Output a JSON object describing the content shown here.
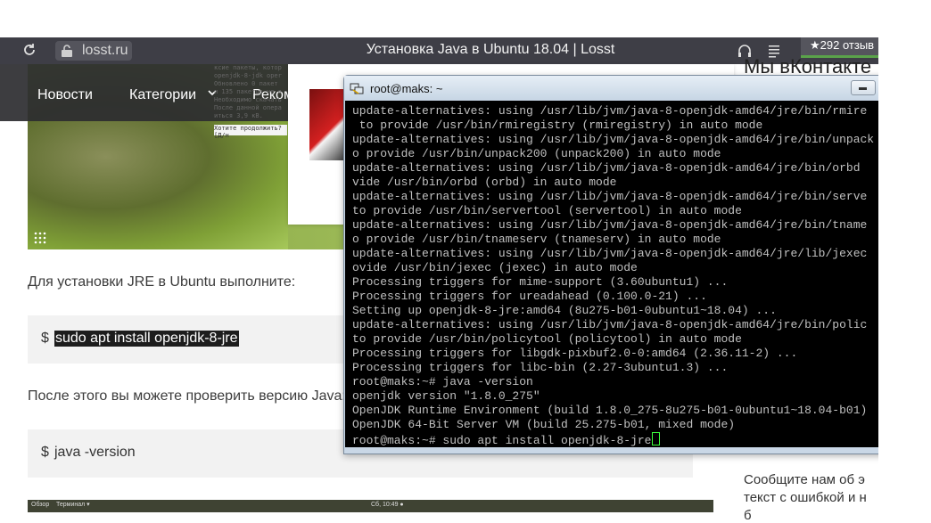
{
  "browser": {
    "url": "losst.ru",
    "page_title": "Установка Java в Ubuntu 18.04 | Losst",
    "reviews_badge": "★292 отзыв"
  },
  "nav": {
    "items": [
      "Новости",
      "Категории",
      "Реком"
    ]
  },
  "ghost_terminal": {
    "text": "ксие пакеты, котор\nopenjdk-8-jdk oper\nОбновлено 0 пакет\nи 135 пакетов не о\nНеобходимо скачать\nПосле данной опера\nиться 3,9 кВ.",
    "prompt": "Хотите продолжить? [Д/н"
  },
  "right_column": {
    "heading": "Мы вКонтакте",
    "text_lines": [
      "Сообщите нам об э",
      "текст с ошибкой и н",
      "б"
    ]
  },
  "article": {
    "para1": "Для установки JRE в Ubuntu выполните:",
    "code1_prompt": "$",
    "code1_cmd": "sudo apt install openjdk-8-jre",
    "para2": "После этого вы можете проверить версию Java:",
    "code2_prompt": "$",
    "code2_cmd": "java -version"
  },
  "bottom_strip": {
    "left": "Обзор",
    "app": "Терминал ▾",
    "clock": "Сб, 10:49 ●"
  },
  "terminal": {
    "title": "root@maks: ~",
    "lines": [
      "update-alternatives: using /usr/lib/jvm/java-8-openjdk-amd64/jre/bin/rmire",
      " to provide /usr/bin/rmiregistry (rmiregistry) in auto mode",
      "update-alternatives: using /usr/lib/jvm/java-8-openjdk-amd64/jre/bin/unpack",
      "o provide /usr/bin/unpack200 (unpack200) in auto mode",
      "update-alternatives: using /usr/lib/jvm/java-8-openjdk-amd64/jre/bin/orbd",
      "vide /usr/bin/orbd (orbd) in auto mode",
      "update-alternatives: using /usr/lib/jvm/java-8-openjdk-amd64/jre/bin/serve",
      "to provide /usr/bin/servertool (servertool) in auto mode",
      "update-alternatives: using /usr/lib/jvm/java-8-openjdk-amd64/jre/bin/tname",
      "o provide /usr/bin/tnameserv (tnameserv) in auto mode",
      "update-alternatives: using /usr/lib/jvm/java-8-openjdk-amd64/jre/lib/jexec",
      "ovide /usr/bin/jexec (jexec) in auto mode",
      "Processing triggers for mime-support (3.60ubuntu1) ...",
      "Processing triggers for ureadahead (0.100.0-21) ...",
      "Setting up openjdk-8-jre:amd64 (8u275-b01-0ubuntu1~18.04) ...",
      "update-alternatives: using /usr/lib/jvm/java-8-openjdk-amd64/jre/bin/polic",
      "to provide /usr/bin/policytool (policytool) in auto mode",
      "Processing triggers for libgdk-pixbuf2.0-0:amd64 (2.36.11-2) ...",
      "Processing triggers for libc-bin (2.27-3ubuntu1.3) ...",
      "root@maks:~# java -version",
      "openjdk version \"1.8.0_275\"",
      "OpenJDK Runtime Environment (build 1.8.0_275-8u275-b01-0ubuntu1~18.04-b01)",
      "OpenJDK 64-Bit Server VM (build 25.275-b01, mixed mode)"
    ],
    "current_command": "root@maks:~# sudo apt install openjdk-8-jre"
  },
  "colors": {
    "browser_bar": "#3e3e46",
    "accent_green": "#5aa34a",
    "terminal_bg": "#000000",
    "terminal_text": "#c0c0c0",
    "cursor": "#3cff3c"
  }
}
